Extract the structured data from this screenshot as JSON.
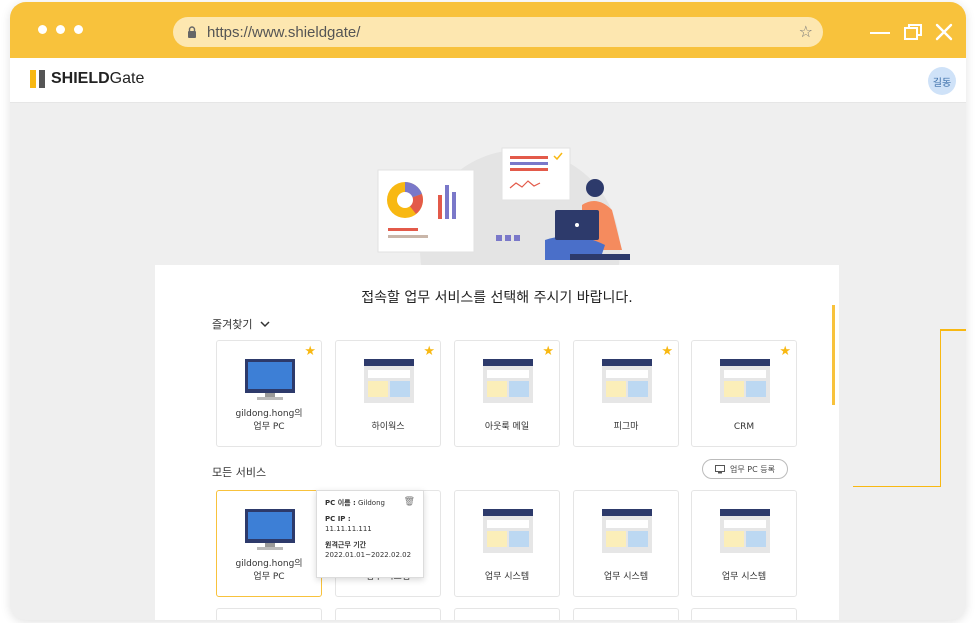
{
  "browser": {
    "url": "https://www.shieldgate/",
    "window_controls": {
      "minimize": "—",
      "maximize": "❐",
      "close": "✕"
    }
  },
  "app": {
    "logo_bold": "SHIELD",
    "logo_regular": "Gate",
    "avatar_text": "길동"
  },
  "main": {
    "headline": "접속할 업무 서비스를 선택해 주시기 바랍니다.",
    "favorites_label": "즐겨찾기",
    "favorites": [
      {
        "label": "gildong.hong의\n업무 PC",
        "icon": "monitor-icon",
        "starred": true
      },
      {
        "label": "하이웍스",
        "icon": "browser-window-icon",
        "starred": true
      },
      {
        "label": "아웃룩 메일",
        "icon": "browser-window-icon",
        "starred": true
      },
      {
        "label": "피그마",
        "icon": "browser-window-icon",
        "starred": true
      },
      {
        "label": "CRM",
        "icon": "browser-window-icon",
        "starred": true
      }
    ],
    "all_services_label": "모든 서비스",
    "register_button": "업무 PC 등록",
    "all_services": [
      {
        "label": "gildong.hong의\n업무 PC",
        "icon": "monitor-icon"
      },
      {
        "label": "업무 시스템",
        "icon": "browser-window-icon"
      },
      {
        "label": "업무 시스템",
        "icon": "browser-window-icon"
      },
      {
        "label": "업무 시스템",
        "icon": "browser-window-icon"
      },
      {
        "label": "업무 시스템",
        "icon": "browser-window-icon"
      }
    ],
    "tooltip": {
      "pc_name_key": "PC 이름 :",
      "pc_name_value": " Gildong",
      "pc_ip_key": "PC IP :",
      "pc_ip_value": "11.11.11.111",
      "remote_key": "원격근무 기간",
      "remote_value": "2022.01.01~2022.02.02"
    }
  },
  "colors": {
    "accent": "#f8c23c",
    "star": "#f8b812",
    "navy": "#2d3a6b",
    "panel_yellow": "#fbeeb9",
    "panel_blue": "#bcd8f2"
  }
}
